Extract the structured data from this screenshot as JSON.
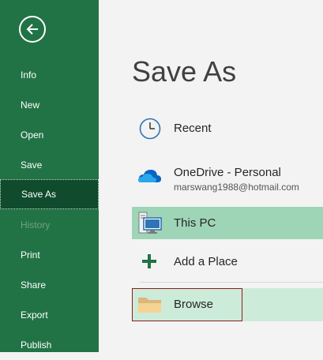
{
  "sidebar": {
    "back_icon": "back-arrow-icon",
    "items": [
      {
        "label": "Info"
      },
      {
        "label": "New"
      },
      {
        "label": "Open"
      },
      {
        "label": "Save"
      },
      {
        "label": "Save As"
      },
      {
        "label": "History"
      },
      {
        "label": "Print"
      },
      {
        "label": "Share"
      },
      {
        "label": "Export"
      },
      {
        "label": "Publish"
      }
    ],
    "selected": "Save As",
    "disabled": [
      "History"
    ]
  },
  "main": {
    "title": "Save As",
    "locations": [
      {
        "label": "Recent",
        "icon": "clock-icon"
      },
      {
        "label": "OneDrive - Personal",
        "sub": "marswang1988@hotmail.com",
        "icon": "onedrive-cloud-icon"
      },
      {
        "label": "This PC",
        "icon": "computer-icon"
      },
      {
        "label": "Add a Place",
        "icon": "plus-icon"
      },
      {
        "label": "Browse",
        "icon": "folder-icon"
      }
    ]
  },
  "colors": {
    "sidebar": "#217346",
    "selected": "#0f4b2c",
    "this_pc_highlight": "#9fd5b7",
    "browse_highlight": "#cdebd9"
  }
}
